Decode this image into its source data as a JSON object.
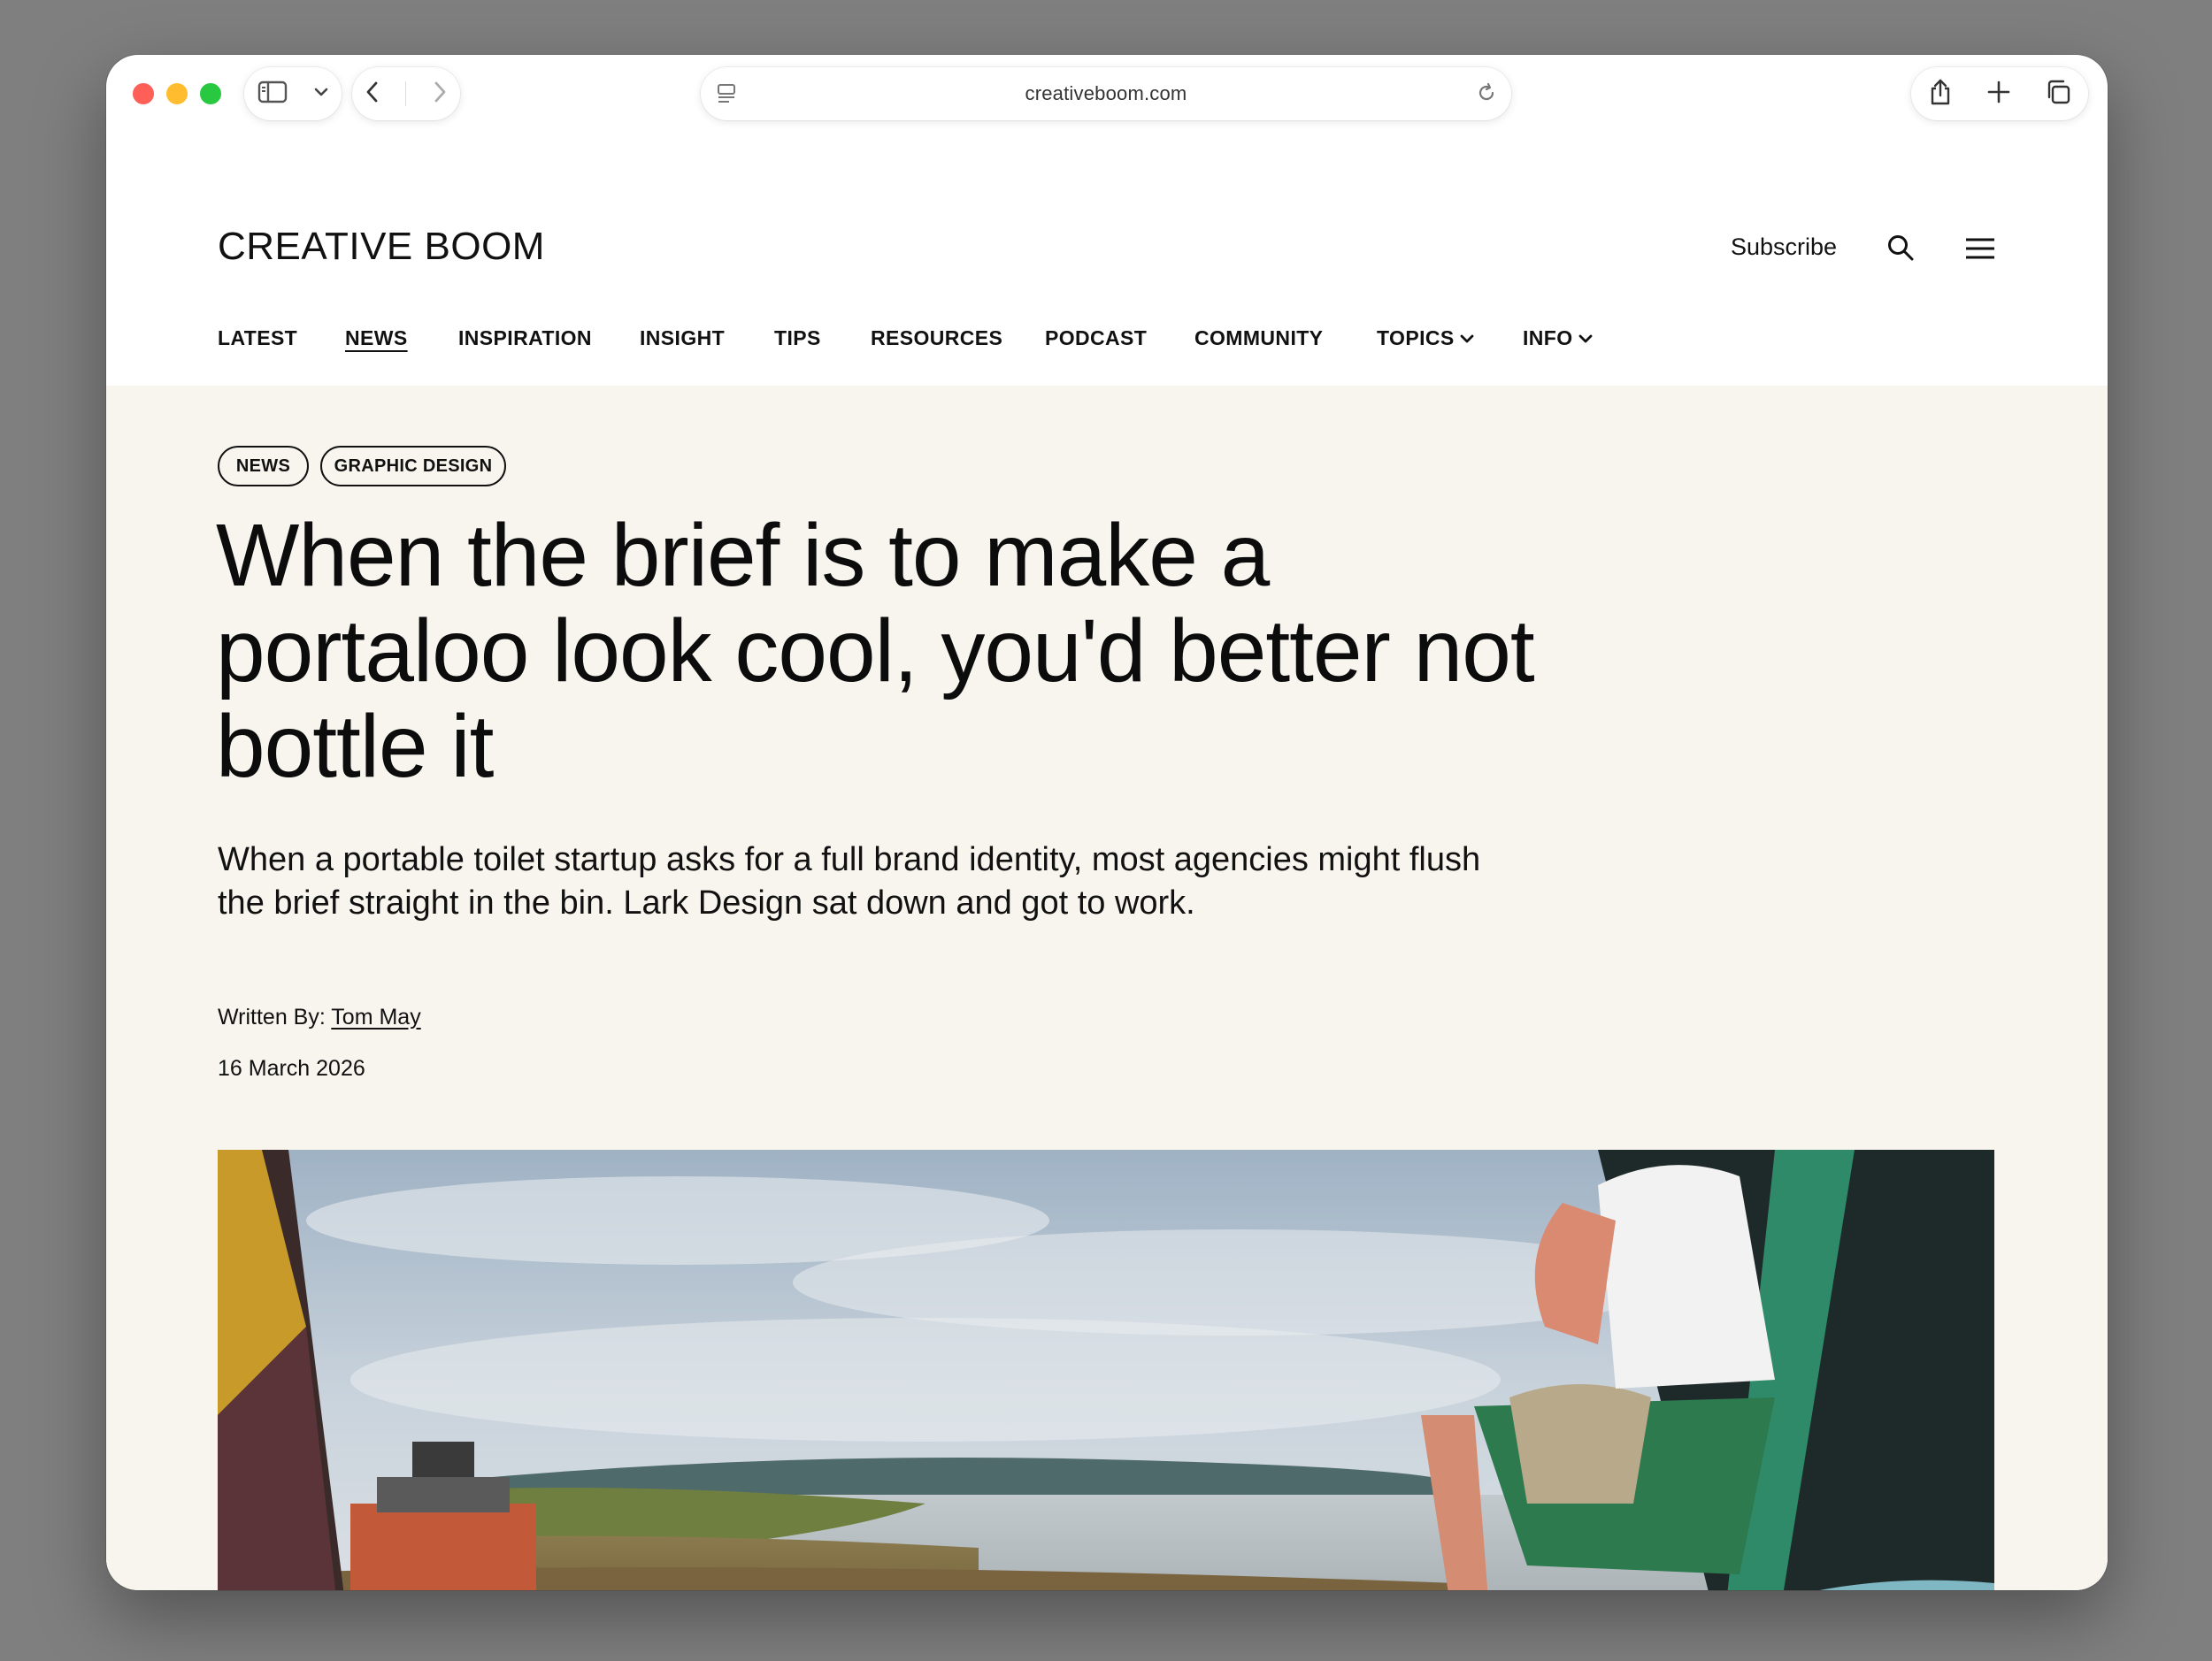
{
  "browser": {
    "url": "creativeboom.com"
  },
  "site": {
    "logo": "CREATIVE BOOM",
    "subscribe": "Subscribe"
  },
  "nav": [
    {
      "label": "LATEST"
    },
    {
      "label": "NEWS"
    },
    {
      "label": "INSPIRATION"
    },
    {
      "label": "INSIGHT"
    },
    {
      "label": "TIPS"
    },
    {
      "label": "RESOURCES"
    },
    {
      "label": "PODCAST"
    },
    {
      "label": "COMMUNITY"
    },
    {
      "label": "TOPICS"
    },
    {
      "label": "INFO"
    }
  ],
  "article": {
    "tags": [
      "NEWS",
      "GRAPHIC DESIGN"
    ],
    "headline": "When the brief is to make a portaloo look cool, you'd better not bottle it",
    "standfirst": "When a portable toilet startup asks for a full brand identity, most agencies might flush the brief straight in the bin. Lark Design sat down and got to work.",
    "byline_prefix": "Written By:",
    "author": "Tom May",
    "date": "16 March 2026"
  },
  "colors": {
    "article_bg": "#f8f5ef",
    "page_bg": "#7f7f7f",
    "text": "#111111"
  }
}
